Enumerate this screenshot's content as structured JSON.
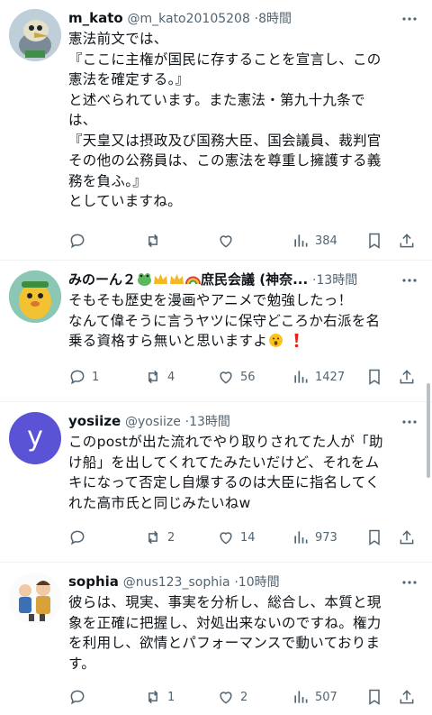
{
  "posts": [
    {
      "name": "m_kato",
      "handle": "@m_kato20105208",
      "sep": "·",
      "time": "8時間",
      "lines": [
        "憲法前文では、",
        "『ここに主権が国民に存することを宣言し、この",
        "憲法を確定する。』",
        "と述べられています。また憲法・第九十九条で",
        "は、",
        "『天皇又は摂政及び国務大臣、国会議員、裁判官",
        "その他の公務員は、この憲法を尊重し擁護する義",
        "務を負ふ。』",
        "としていますね。"
      ],
      "replies": "",
      "reposts": "",
      "likes": "",
      "views": "384"
    },
    {
      "name": "みのーん２",
      "name_tail": "庶民会議 (神奈...",
      "handle": "",
      "sep": "·",
      "time": "13時間",
      "lines": [
        "そもそも歴史を漫画やアニメで勉強したっ！",
        "なんて偉そうに言うヤツに保守どころか右派を名",
        "乗る資格すら無いと思いますよ"
      ],
      "replies": "1",
      "reposts": "4",
      "likes": "56",
      "views": "1427",
      "avatar_letter": ""
    },
    {
      "name": "yosiize",
      "handle": "@yosiize",
      "sep": "·",
      "time": "13時間",
      "lines": [
        "このpostが出た流れでやり取りされてた人が「助",
        "け船」を出してくれてたみたいだけど、それをム",
        "キになって否定し自爆するのは大臣に指名してく",
        "れた高市氏と同じみたいねw"
      ],
      "replies": "",
      "reposts": "2",
      "likes": "14",
      "views": "973",
      "avatar_letter": "y"
    },
    {
      "name": "sophia",
      "handle": "@nus123_sophia",
      "sep": "·",
      "time": "10時間",
      "lines": [
        "彼らは、現実、事実を分析し、総合し、本質と現",
        "象を正確に把握し、対処出来ないのですね。権力",
        "を利用し、欲情とパフォーマンスで動いておりま",
        "す。"
      ],
      "replies": "",
      "reposts": "1",
      "likes": "2",
      "views": "507"
    }
  ],
  "colors": {
    "yosiize_avatar": "#5b53d6",
    "icon_gray": "#536471"
  },
  "icons": [
    "reply-icon",
    "repost-icon",
    "like-icon",
    "views-icon",
    "bookmark-icon",
    "share-icon",
    "more-icon"
  ]
}
